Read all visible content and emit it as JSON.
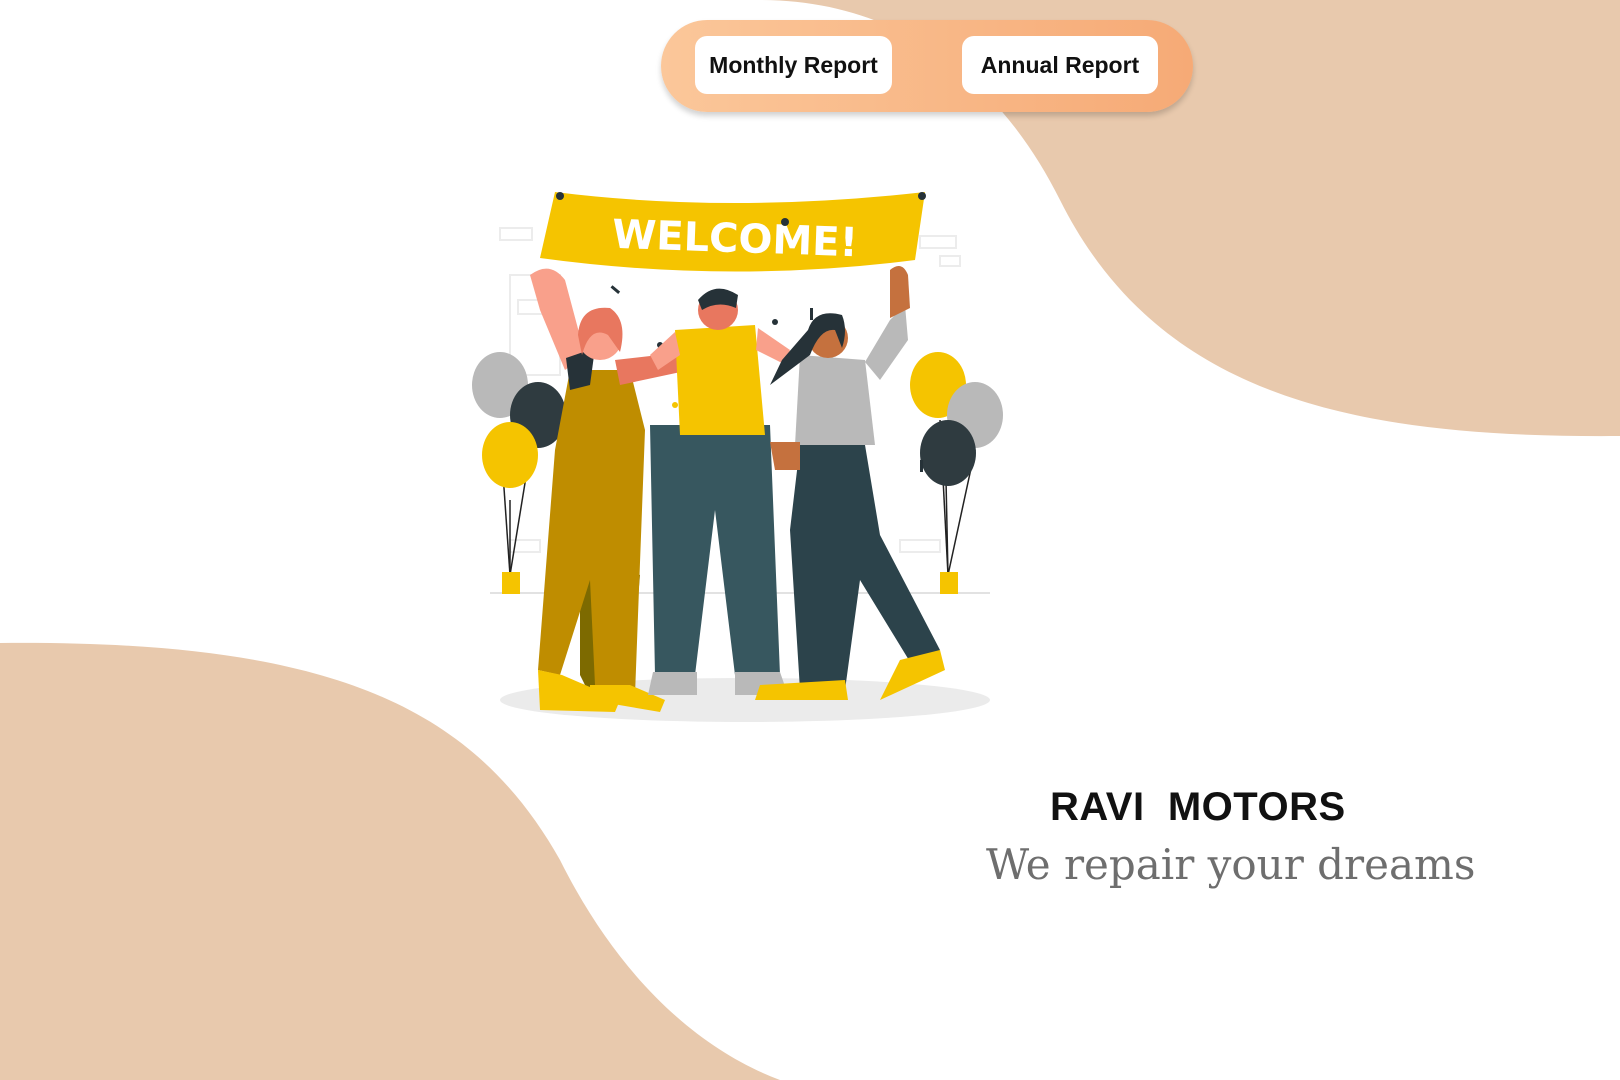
{
  "nav": {
    "monthly_label": "Monthly Report",
    "annual_label": "Annual Report"
  },
  "banner": {
    "text": "WELCOME!"
  },
  "brand": {
    "name": "RAVI  MOTORS",
    "tagline": "We repair your dreams"
  },
  "colors": {
    "blob": "#e8c9ad",
    "pill_start": "#fbc79a",
    "pill_end": "#f6aa76",
    "accent_yellow": "#f5c400",
    "tagline_gray": "#6e6e6e"
  }
}
